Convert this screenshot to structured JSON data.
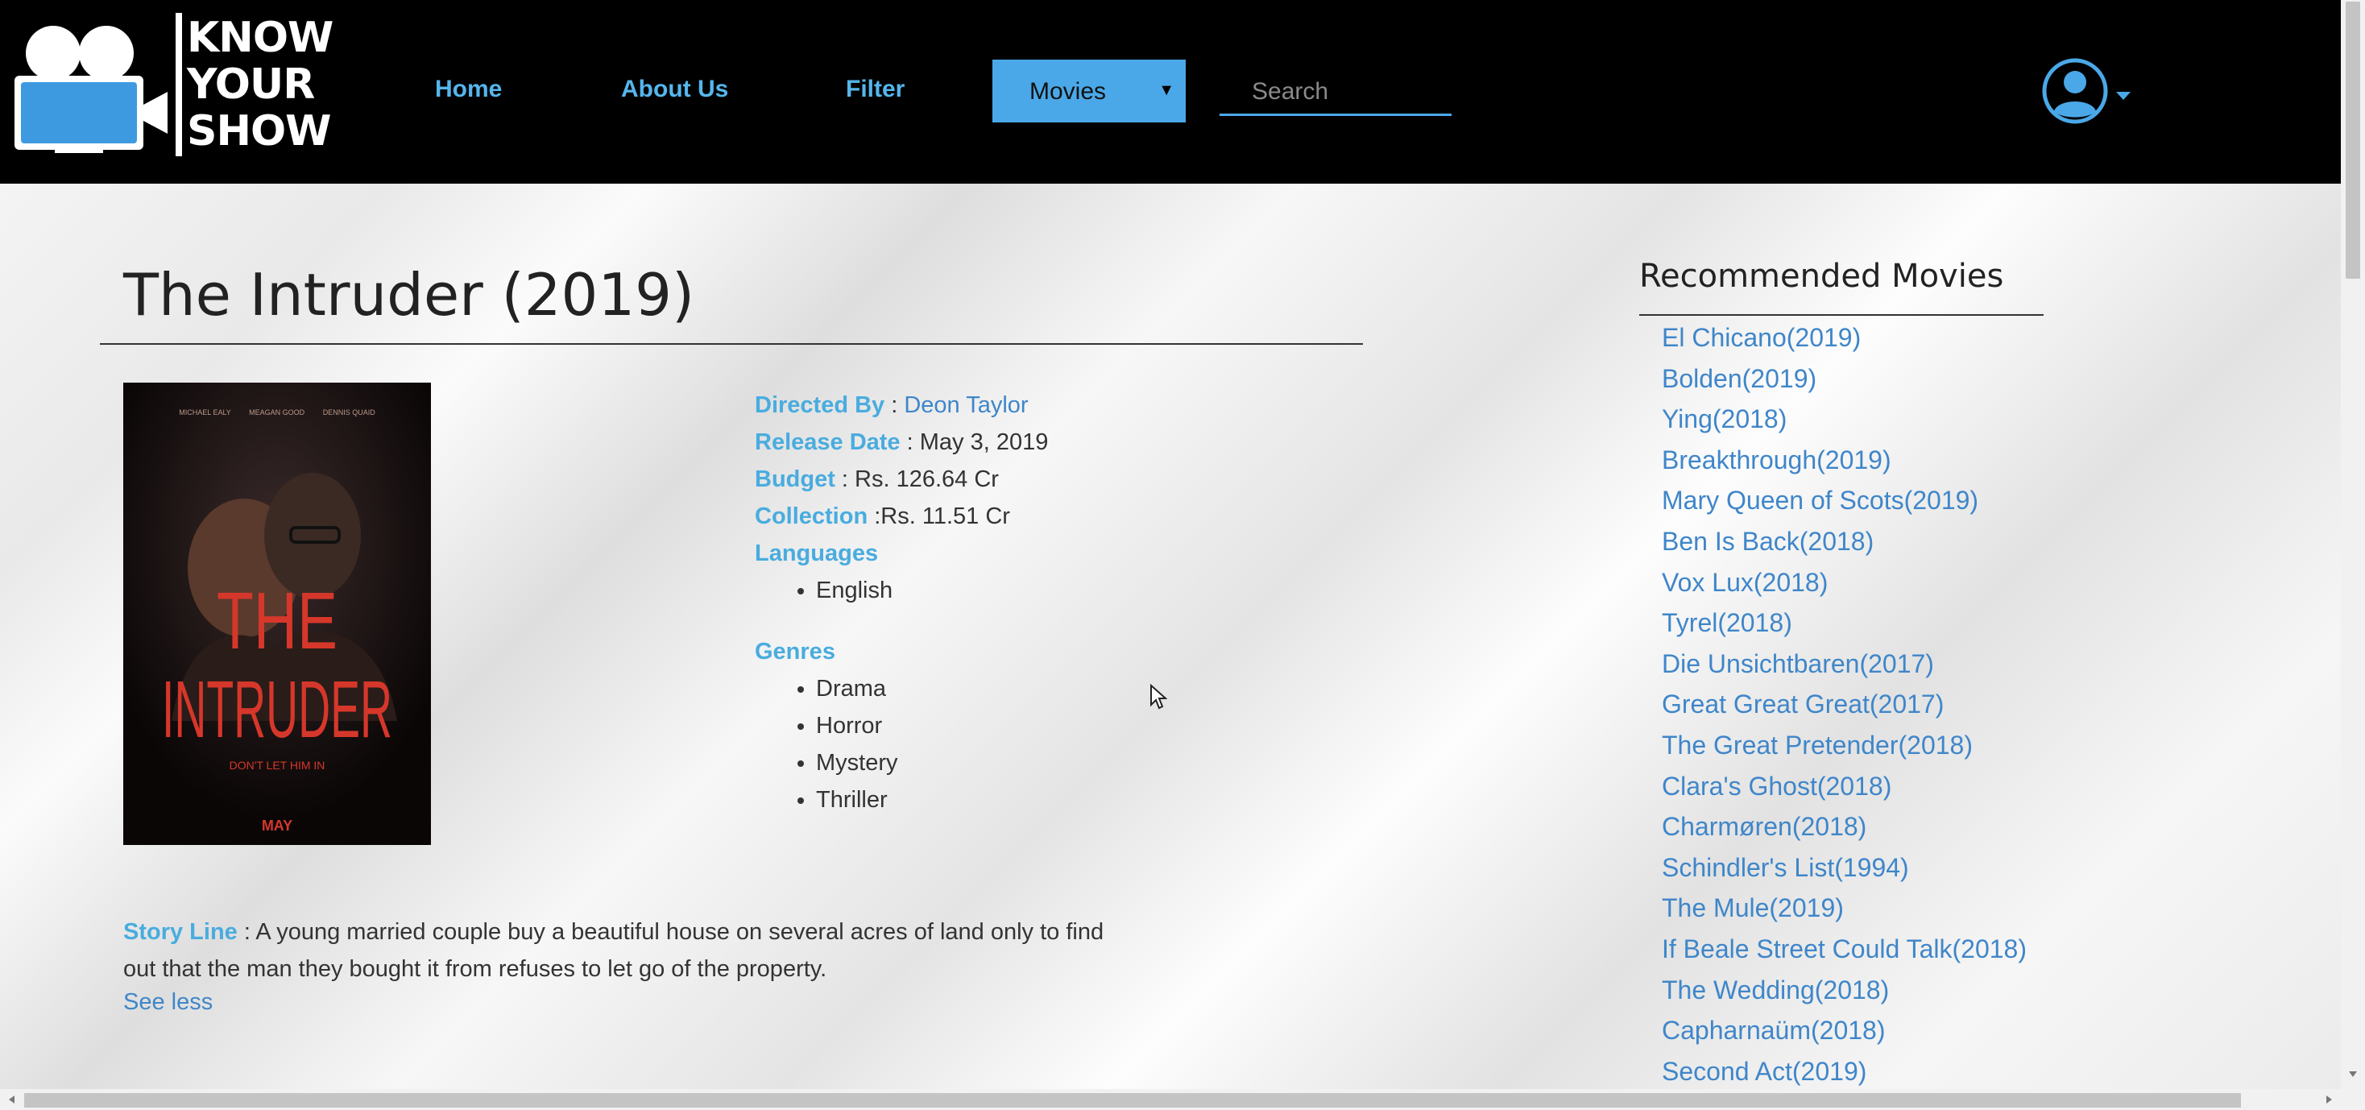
{
  "navbar": {
    "logo_text_line1": "KNOW",
    "logo_text_line2": "YOUR",
    "logo_text_line3": "SHOW",
    "home": "Home",
    "about": "About Us",
    "filter": "Filter",
    "category_select": "Movies",
    "search_placeholder": "Search",
    "accent_color": "#4aa8e8",
    "avatar_icon": "user-circle-icon"
  },
  "movie": {
    "title": "The Intruder (2019)",
    "poster_alt": "The Intruder poster",
    "poster_text": {
      "title_line1": "THE",
      "title_line2": "INTRUDER",
      "tagline": "DON'T LET HIM IN",
      "release": "MAY",
      "cast": [
        "MICHAEL EALY",
        "MEAGAN GOOD",
        "DENNIS QUAID"
      ]
    },
    "directed_by_label": "Directed By",
    "director": "Deon Taylor",
    "release_label": "Release Date",
    "release_date": "May 3, 2019",
    "budget_label": "Budget",
    "budget": "Rs. 126.64 Cr",
    "collection_label": "Collection",
    "collection": "Rs. 11.51 Cr",
    "languages_label": "Languages",
    "languages": [
      "English"
    ],
    "genres_label": "Genres",
    "genres": [
      "Drama",
      "Horror",
      "Mystery",
      "Thriller"
    ],
    "storyline_label": "Story Line",
    "storyline": "A young married couple buy a beautiful house on several acres of land only to find out that the man they bought it from refuses to let go of the property.",
    "see_less": "See less"
  },
  "recommended": {
    "title": "Recommended Movies",
    "items": [
      "El Chicano(2019)",
      "Bolden(2019)",
      "Ying(2018)",
      "Breakthrough(2019)",
      "Mary Queen of Scots(2019)",
      "Ben Is Back(2018)",
      "Vox Lux(2018)",
      "Tyrel(2018)",
      "Die Unsichtbaren(2017)",
      "Great Great Great(2017)",
      "The Great Pretender(2018)",
      "Clara's Ghost(2018)",
      "Charmøren(2018)",
      "Schindler's List(1994)",
      "The Mule(2019)",
      "If Beale Street Could Talk(2018)",
      "The Wedding(2018)",
      "Capharnaüm(2018)",
      "Second Act(2019)"
    ]
  }
}
